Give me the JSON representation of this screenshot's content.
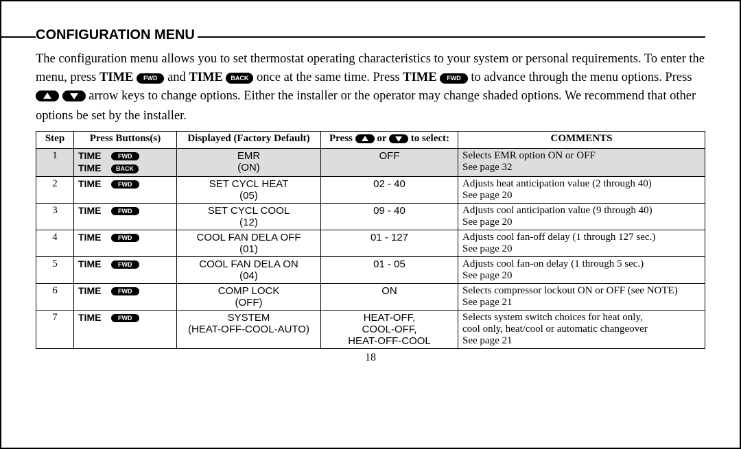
{
  "title": "Configuration Menu",
  "intro": {
    "p1a": "The configuration menu allows you to set thermostat operating characteristics to your system or personal requirements. To enter the menu, press ",
    "time": "TIME",
    "fwd": "FWD",
    "back": "BACK",
    "p1b": " and ",
    "p1c": " once at the same time. Press ",
    "p1d": " to advance through the menu options. Press ",
    "p1e": " arrow keys to change options. Either the installer or the operator may change shaded options. We recommend that other options be set by the installer."
  },
  "headers": {
    "step": "Step",
    "press": "Press Buttons(s)",
    "displayed": "Displayed (Factory Default)",
    "select_a": "Press ",
    "select_b": " or ",
    "select_c": " to select:",
    "comments": "COMMENTS"
  },
  "rows": [
    {
      "step": "1",
      "buttons": [
        "TIME FWD",
        "TIME BACK"
      ],
      "displayed": "EMR\n(ON)",
      "select": "OFF",
      "comments": "Selects EMR option ON or OFF\nSee page 32",
      "shaded": true
    },
    {
      "step": "2",
      "buttons": [
        "TIME FWD"
      ],
      "displayed": "SET CYCL HEAT\n(05)",
      "select": "02 - 40",
      "comments": "Adjusts heat anticipation value (2 through 40)\nSee page 20",
      "shaded": false
    },
    {
      "step": "3",
      "buttons": [
        "TIME FWD"
      ],
      "displayed": "SET CYCL COOL\n(12)",
      "select": "09 - 40",
      "comments": "Adjusts cool anticipation value (9 through 40)\nSee page 20",
      "shaded": false
    },
    {
      "step": "4",
      "buttons": [
        "TIME FWD"
      ],
      "displayed": "COOL FAN DELA OFF\n(01)",
      "select": "01 - 127",
      "comments": "Adjusts cool fan-off delay (1 through 127 sec.)\nSee page 20",
      "shaded": false
    },
    {
      "step": "5",
      "buttons": [
        "TIME FWD"
      ],
      "displayed": "COOL FAN DELA ON\n(04)",
      "select": "01 - 05",
      "comments": "Adjusts cool fan-on delay (1 through 5 sec.)\nSee page 20",
      "shaded": false
    },
    {
      "step": "6",
      "buttons": [
        "TIME FWD"
      ],
      "displayed": "COMP LOCK\n(OFF)",
      "select": "ON",
      "comments": "Selects compressor lockout ON or OFF (see NOTE)\nSee page 21",
      "shaded": false
    },
    {
      "step": "7",
      "buttons": [
        "TIME FWD"
      ],
      "displayed": "SYSTEM\n(HEAT-OFF-COOL-AUTO)",
      "select": "HEAT-OFF,\nCOOL-OFF,\nHEAT-OFF-COOL",
      "comments": "Selects system switch choices for heat only,\ncool only, heat/cool or automatic changeover\nSee page 21",
      "shaded": false
    }
  ],
  "pageNumber": "18",
  "labels": {
    "time": "TIME",
    "fwd": "FWD",
    "back": "BACK"
  }
}
